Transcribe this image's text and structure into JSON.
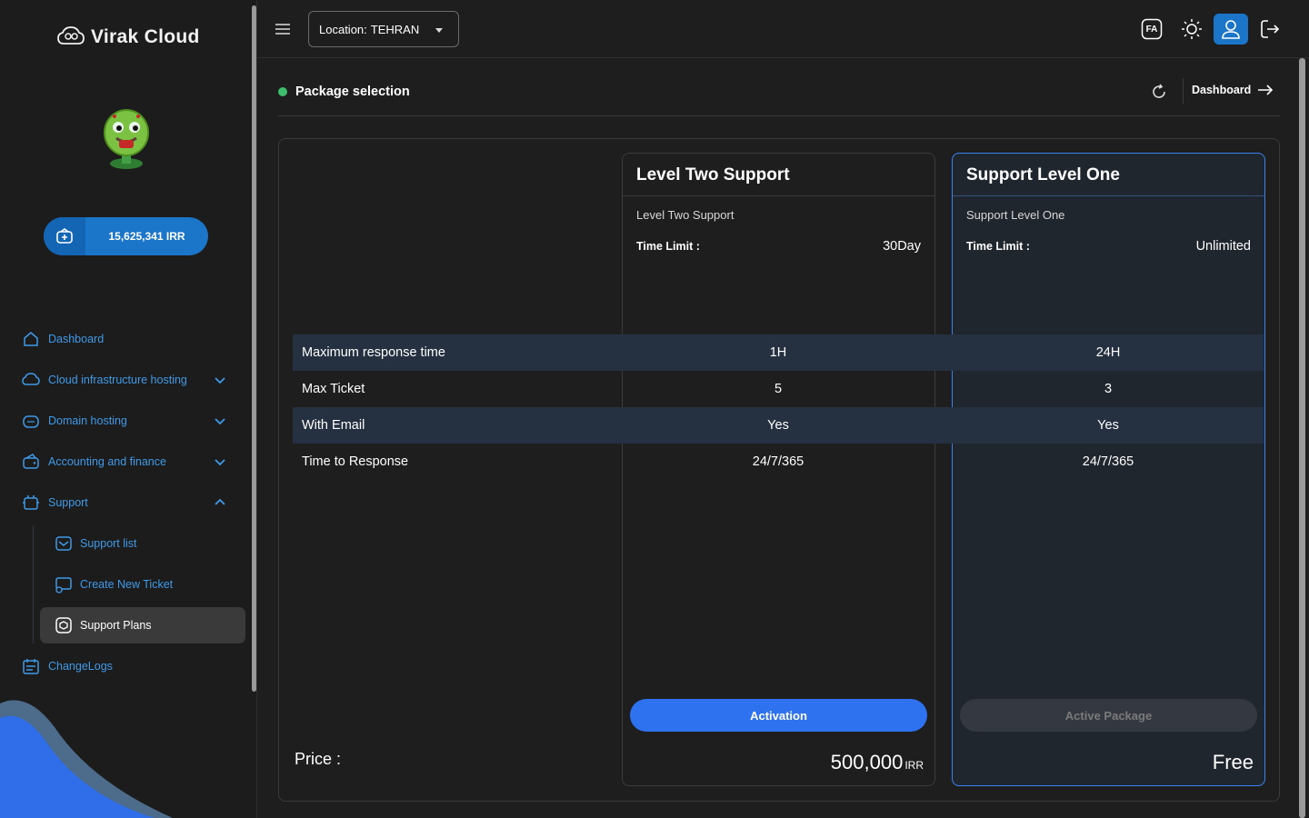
{
  "app": {
    "brand": "Virak Cloud"
  },
  "sidebar": {
    "balance": "15,625,341 IRR",
    "items": [
      {
        "label": "Dashboard"
      },
      {
        "label": "Cloud infrastructure hosting"
      },
      {
        "label": "Domain hosting"
      },
      {
        "label": "Accounting and finance"
      },
      {
        "label": "Support"
      },
      {
        "label": "ChangeLogs"
      }
    ],
    "support_sub": [
      {
        "label": "Support list"
      },
      {
        "label": "Create New Ticket"
      },
      {
        "label": "Support Plans"
      }
    ]
  },
  "topbar": {
    "location_label": "Location:",
    "location_value": "TEHRAN",
    "lang": "FA"
  },
  "header": {
    "title": "Package selection",
    "dashboard_link": "Dashboard"
  },
  "plans": {
    "rows": [
      {
        "label": "Maximum response time",
        "v1": "1H",
        "v2": "24H"
      },
      {
        "label": "Max Ticket",
        "v1": "5",
        "v2": "3"
      },
      {
        "label": "With Email",
        "v1": "Yes",
        "v2": "Yes"
      },
      {
        "label": "Time to Response",
        "v1": "24/7/365",
        "v2": "24/7/365"
      }
    ],
    "price_label": "Price :",
    "cards": [
      {
        "title": "Level Two Support",
        "subtitle": "Level Two Support",
        "time_limit_label": "Time Limit :",
        "time_limit_value": "30Day",
        "button": "Activation",
        "price": "500,000",
        "currency": "IRR"
      },
      {
        "title": "Support Level One",
        "subtitle": "Support Level One",
        "time_limit_label": "Time Limit :",
        "time_limit_value": "Unlimited",
        "button": "Active Package",
        "price": "Free"
      }
    ]
  },
  "colors": {
    "accent": "#1b75c9",
    "nav_text": "#3f9ae8",
    "status_dot": "#3fbf6e",
    "selected_border": "#3b82f6",
    "activation_button": "#2f72f0"
  }
}
